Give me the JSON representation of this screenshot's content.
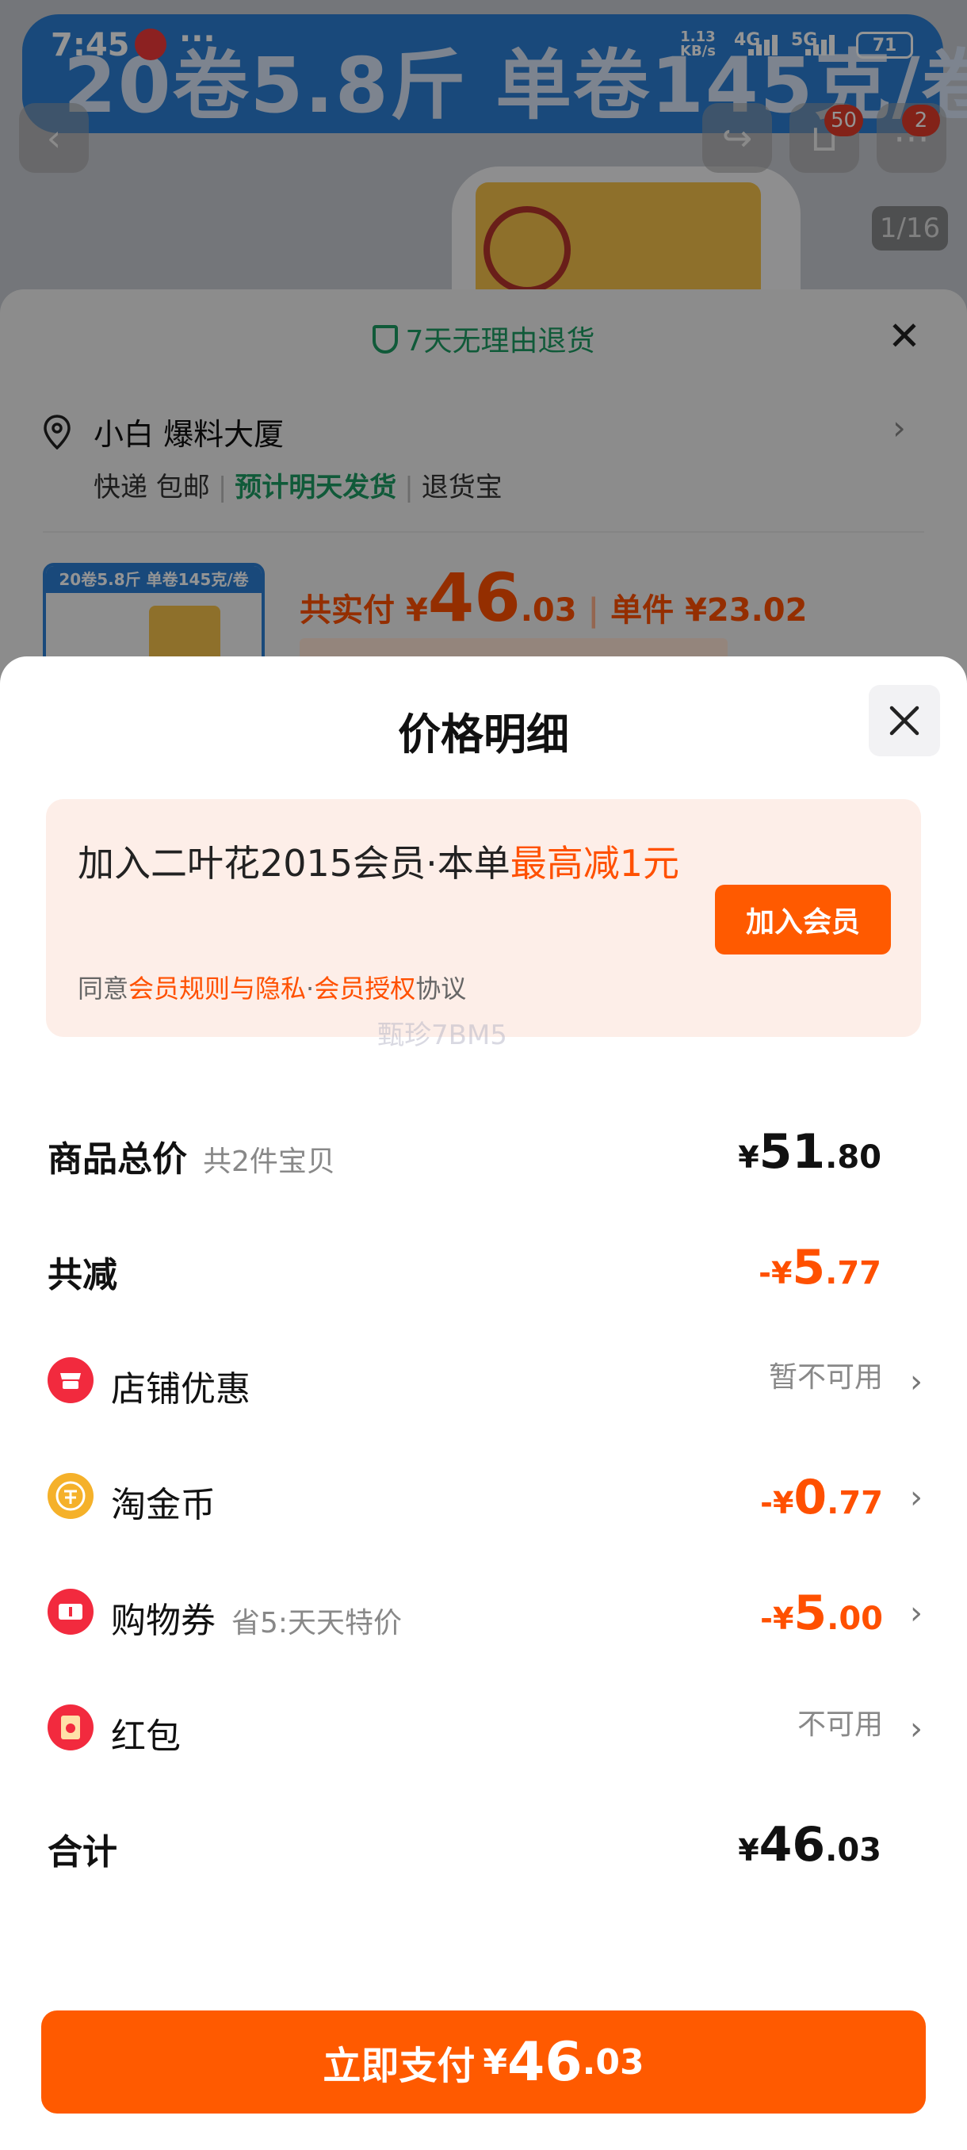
{
  "status_bar": {
    "time": "7:45",
    "dots": "···",
    "net_speed": "1.13",
    "net_unit": "KB/s",
    "sig1": "4G",
    "sig2": "5G",
    "battery": "71"
  },
  "background": {
    "banner_text": "20卷5.8斤  单卷145克/卷",
    "cart_badge": "50",
    "more_badge": "2",
    "image_counter": "1/16",
    "return_policy": "7天无理由退货",
    "address": "小白 爆料大厦",
    "delivery": {
      "method": "快递 包邮",
      "eta": "预计明天发货",
      "service": "退货宝"
    },
    "thumb_label": "20卷5.8斤  单卷145克/卷",
    "pay_label": "共实付",
    "pay_currency": "¥",
    "pay_int": "46",
    "pay_dec": ".03",
    "unit_label": "单件 ¥23.02"
  },
  "sheet": {
    "title": "价格明细",
    "member": {
      "line_prefix": "加入二叶花2015会员·本单",
      "line_highlight": "最高减1元",
      "agree_prefix": "同意",
      "agree_link1": "会员规则与隐私",
      "agree_mid": "·",
      "agree_link2": "会员授权",
      "agree_suffix": "协议",
      "join_button": "加入会员"
    },
    "watermark": "甄珍7BM5",
    "rows": {
      "total": {
        "label": "商品总价",
        "sub": "共2件宝贝",
        "cur": "¥",
        "int": "51",
        "dec": ".80"
      },
      "reduce": {
        "label": "共减",
        "cur": "-¥",
        "int": "5",
        "dec": ".77"
      },
      "shop": {
        "label": "店铺优惠",
        "value": "暂不可用"
      },
      "coin": {
        "label": "淘金币",
        "cur": "-¥",
        "int": "0",
        "dec": ".77"
      },
      "coupon": {
        "label": "购物券",
        "sub": "省5:天天特价",
        "cur": "-¥",
        "int": "5",
        "dec": ".00"
      },
      "redpacket": {
        "label": "红包",
        "value": "不可用"
      },
      "sum": {
        "label": "合计",
        "cur": "¥",
        "int": "46",
        "dec": ".03"
      }
    },
    "pay_button": {
      "label": "立即支付",
      "cur": "¥",
      "int": "46",
      "dec": ".03"
    }
  },
  "colors": {
    "accent": "#ff5000",
    "button": "#ff5a00",
    "green": "#1d9b63",
    "member_bg": "#fdeee8"
  }
}
